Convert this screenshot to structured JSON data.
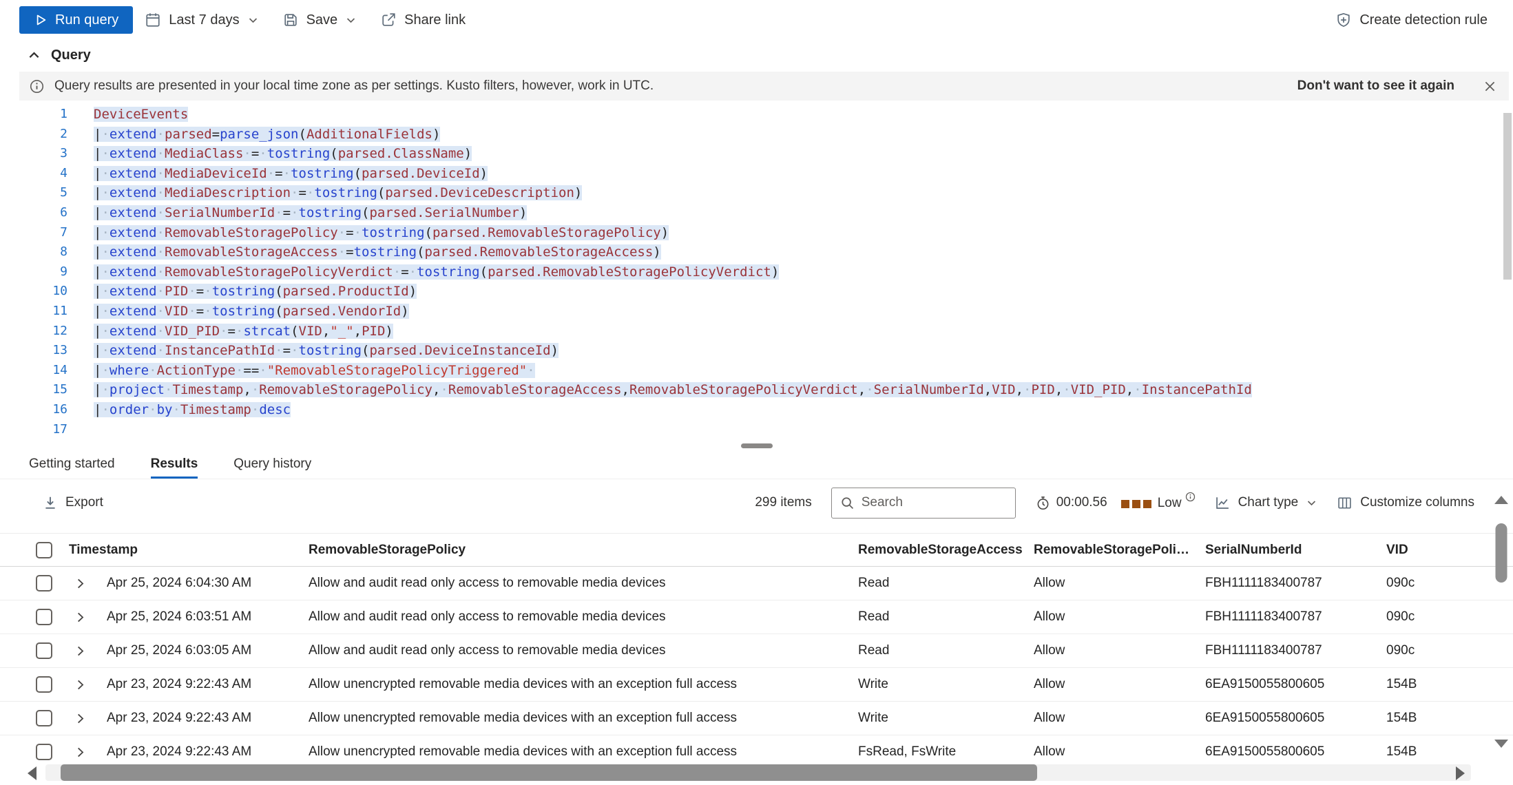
{
  "colors": {
    "accent": "#1065c0",
    "run_button_bg": "#1065c0",
    "tab_underline": "#1065c0",
    "code_selection_bg": "#dbe7f6",
    "code_keyword": "#2743cd",
    "code_column": "#9a3339",
    "code_string": "#c0392e",
    "code_line_number": "#2472c8",
    "resource_indicator": "#9a4f12"
  },
  "command_bar": {
    "run_query": "Run query",
    "time_range": "Last 7 days",
    "save": "Save",
    "share_link": "Share link",
    "create_detection_rule": "Create detection rule"
  },
  "query_section": {
    "title": "Query",
    "banner": {
      "message": "Query results are presented in your local time zone as per settings. Kusto filters, however, work in UTC.",
      "dismiss_label": "Don't want to see it again"
    }
  },
  "editor": {
    "lines": [
      {
        "n": 1,
        "tokens": [
          [
            "col",
            "DeviceEvents"
          ]
        ]
      },
      {
        "n": 2,
        "tokens": [
          [
            "p",
            "|"
          ],
          [
            "ws",
            "·"
          ],
          [
            "kw",
            "extend"
          ],
          [
            "ws",
            "·"
          ],
          [
            "col",
            "parsed"
          ],
          [
            "p",
            "="
          ],
          [
            "fn",
            "parse_json"
          ],
          [
            "p",
            "("
          ],
          [
            "col",
            "AdditionalFields"
          ],
          [
            "p",
            ")"
          ]
        ]
      },
      {
        "n": 3,
        "tokens": [
          [
            "p",
            "|"
          ],
          [
            "ws",
            "·"
          ],
          [
            "kw",
            "extend"
          ],
          [
            "ws",
            "·"
          ],
          [
            "col",
            "MediaClass"
          ],
          [
            "ws",
            "·"
          ],
          [
            "p",
            "="
          ],
          [
            "ws",
            "·"
          ],
          [
            "fn",
            "tostring"
          ],
          [
            "p",
            "("
          ],
          [
            "col",
            "parsed.ClassName"
          ],
          [
            "p",
            ")"
          ]
        ]
      },
      {
        "n": 4,
        "tokens": [
          [
            "p",
            "|"
          ],
          [
            "ws",
            "·"
          ],
          [
            "kw",
            "extend"
          ],
          [
            "ws",
            "·"
          ],
          [
            "col",
            "MediaDeviceId"
          ],
          [
            "ws",
            "·"
          ],
          [
            "p",
            "="
          ],
          [
            "ws",
            "·"
          ],
          [
            "fn",
            "tostring"
          ],
          [
            "p",
            "("
          ],
          [
            "col",
            "parsed.DeviceId"
          ],
          [
            "p",
            ")"
          ]
        ]
      },
      {
        "n": 5,
        "tokens": [
          [
            "p",
            "|"
          ],
          [
            "ws",
            "·"
          ],
          [
            "kw",
            "extend"
          ],
          [
            "ws",
            "·"
          ],
          [
            "col",
            "MediaDescription"
          ],
          [
            "ws",
            "·"
          ],
          [
            "p",
            "="
          ],
          [
            "ws",
            "·"
          ],
          [
            "fn",
            "tostring"
          ],
          [
            "p",
            "("
          ],
          [
            "col",
            "parsed.DeviceDescription"
          ],
          [
            "p",
            ")"
          ]
        ]
      },
      {
        "n": 6,
        "tokens": [
          [
            "p",
            "|"
          ],
          [
            "ws",
            "·"
          ],
          [
            "kw",
            "extend"
          ],
          [
            "ws",
            "·"
          ],
          [
            "col",
            "SerialNumberId"
          ],
          [
            "ws",
            "·"
          ],
          [
            "p",
            "="
          ],
          [
            "ws",
            "·"
          ],
          [
            "fn",
            "tostring"
          ],
          [
            "p",
            "("
          ],
          [
            "col",
            "parsed.SerialNumber"
          ],
          [
            "p",
            ")"
          ]
        ]
      },
      {
        "n": 7,
        "tokens": [
          [
            "p",
            "|"
          ],
          [
            "ws",
            "·"
          ],
          [
            "kw",
            "extend"
          ],
          [
            "ws",
            "·"
          ],
          [
            "col",
            "RemovableStoragePolicy"
          ],
          [
            "ws",
            "·"
          ],
          [
            "p",
            "="
          ],
          [
            "ws",
            "·"
          ],
          [
            "fn",
            "tostring"
          ],
          [
            "p",
            "("
          ],
          [
            "col",
            "parsed.RemovableStoragePolicy"
          ],
          [
            "p",
            ")"
          ]
        ]
      },
      {
        "n": 8,
        "tokens": [
          [
            "p",
            "|"
          ],
          [
            "ws",
            "·"
          ],
          [
            "kw",
            "extend"
          ],
          [
            "ws",
            "·"
          ],
          [
            "col",
            "RemovableStorageAccess"
          ],
          [
            "ws",
            "·"
          ],
          [
            "p",
            "="
          ],
          [
            "fn",
            "tostring"
          ],
          [
            "p",
            "("
          ],
          [
            "col",
            "parsed.RemovableStorageAccess"
          ],
          [
            "p",
            ")"
          ]
        ]
      },
      {
        "n": 9,
        "tokens": [
          [
            "p",
            "|"
          ],
          [
            "ws",
            "·"
          ],
          [
            "kw",
            "extend"
          ],
          [
            "ws",
            "·"
          ],
          [
            "col",
            "RemovableStoragePolicyVerdict"
          ],
          [
            "ws",
            "·"
          ],
          [
            "p",
            "="
          ],
          [
            "ws",
            "·"
          ],
          [
            "fn",
            "tostring"
          ],
          [
            "p",
            "("
          ],
          [
            "col",
            "parsed.RemovableStoragePolicyVerdict"
          ],
          [
            "p",
            ")"
          ]
        ]
      },
      {
        "n": 10,
        "tokens": [
          [
            "p",
            "|"
          ],
          [
            "ws",
            "·"
          ],
          [
            "kw",
            "extend"
          ],
          [
            "ws",
            "·"
          ],
          [
            "col",
            "PID"
          ],
          [
            "ws",
            "·"
          ],
          [
            "p",
            "="
          ],
          [
            "ws",
            "·"
          ],
          [
            "fn",
            "tostring"
          ],
          [
            "p",
            "("
          ],
          [
            "col",
            "parsed.ProductId"
          ],
          [
            "p",
            ")"
          ]
        ]
      },
      {
        "n": 11,
        "tokens": [
          [
            "p",
            "|"
          ],
          [
            "ws",
            "·"
          ],
          [
            "kw",
            "extend"
          ],
          [
            "ws",
            "·"
          ],
          [
            "col",
            "VID"
          ],
          [
            "ws",
            "·"
          ],
          [
            "p",
            "="
          ],
          [
            "ws",
            "·"
          ],
          [
            "fn",
            "tostring"
          ],
          [
            "p",
            "("
          ],
          [
            "col",
            "parsed.VendorId"
          ],
          [
            "p",
            ")"
          ]
        ]
      },
      {
        "n": 12,
        "tokens": [
          [
            "p",
            "|"
          ],
          [
            "ws",
            "·"
          ],
          [
            "kw",
            "extend"
          ],
          [
            "ws",
            "·"
          ],
          [
            "col",
            "VID_PID"
          ],
          [
            "ws",
            "·"
          ],
          [
            "p",
            "="
          ],
          [
            "ws",
            "·"
          ],
          [
            "fn",
            "strcat"
          ],
          [
            "p",
            "("
          ],
          [
            "col",
            "VID"
          ],
          [
            "p",
            ","
          ],
          [
            "str",
            "\"_\""
          ],
          [
            "p",
            ","
          ],
          [
            "col",
            "PID"
          ],
          [
            "p",
            ")"
          ]
        ]
      },
      {
        "n": 13,
        "tokens": [
          [
            "p",
            "|"
          ],
          [
            "ws",
            "·"
          ],
          [
            "kw",
            "extend"
          ],
          [
            "ws",
            "·"
          ],
          [
            "col",
            "InstancePathId"
          ],
          [
            "ws",
            "·"
          ],
          [
            "p",
            "="
          ],
          [
            "ws",
            "·"
          ],
          [
            "fn",
            "tostring"
          ],
          [
            "p",
            "("
          ],
          [
            "col",
            "parsed.DeviceInstanceId"
          ],
          [
            "p",
            ")"
          ]
        ]
      },
      {
        "n": 14,
        "tokens": [
          [
            "p",
            "|"
          ],
          [
            "ws",
            "·"
          ],
          [
            "kw",
            "where"
          ],
          [
            "ws",
            "·"
          ],
          [
            "col",
            "ActionType"
          ],
          [
            "ws",
            "·"
          ],
          [
            "p",
            "=="
          ],
          [
            "ws",
            "·"
          ],
          [
            "str",
            "\"RemovableStoragePolicyTriggered\""
          ],
          [
            "ws",
            "·"
          ]
        ]
      },
      {
        "n": 15,
        "tokens": [
          [
            "p",
            "|"
          ],
          [
            "ws",
            "·"
          ],
          [
            "kw",
            "project"
          ],
          [
            "ws",
            "·"
          ],
          [
            "col",
            "Timestamp"
          ],
          [
            "p",
            ","
          ],
          [
            "ws",
            "·"
          ],
          [
            "col",
            "RemovableStoragePolicy"
          ],
          [
            "p",
            ","
          ],
          [
            "ws",
            "·"
          ],
          [
            "col",
            "RemovableStorageAccess"
          ],
          [
            "p",
            ","
          ],
          [
            "col",
            "RemovableStoragePolicyVerdict"
          ],
          [
            "p",
            ","
          ],
          [
            "ws",
            "·"
          ],
          [
            "col",
            "SerialNumberId"
          ],
          [
            "p",
            ","
          ],
          [
            "col",
            "VID"
          ],
          [
            "p",
            ","
          ],
          [
            "ws",
            "·"
          ],
          [
            "col",
            "PID"
          ],
          [
            "p",
            ","
          ],
          [
            "ws",
            "·"
          ],
          [
            "col",
            "VID_PID"
          ],
          [
            "p",
            ","
          ],
          [
            "ws",
            "·"
          ],
          [
            "col",
            "InstancePathId"
          ]
        ]
      },
      {
        "n": 16,
        "tokens": [
          [
            "p",
            "|"
          ],
          [
            "ws",
            "·"
          ],
          [
            "kw",
            "order"
          ],
          [
            "ws",
            "·"
          ],
          [
            "kw",
            "by"
          ],
          [
            "ws",
            "·"
          ],
          [
            "col",
            "Timestamp"
          ],
          [
            "ws",
            "·"
          ],
          [
            "kw",
            "desc"
          ]
        ]
      },
      {
        "n": 17,
        "tokens": []
      }
    ]
  },
  "tabs": [
    {
      "label": "Getting started"
    },
    {
      "label": "Results"
    },
    {
      "label": "Query history"
    }
  ],
  "results_toolbar": {
    "export_label": "Export",
    "items_count": "299 items",
    "search_placeholder": "Search",
    "elapsed_time": "00:00.56",
    "resource_usage_label": "Low",
    "chart_type_label": "Chart type",
    "customize_columns_label": "Customize columns"
  },
  "table": {
    "columns": [
      "Timestamp",
      "RemovableStoragePolicy",
      "RemovableStorageAccess",
      "RemovableStoragePolicyVer...",
      "SerialNumberId",
      "VID"
    ],
    "rows": [
      {
        "timestamp": "Apr 25, 2024 6:04:30 AM",
        "policy": "Allow and audit read only access to removable media devices",
        "access": "Read",
        "verdict": "Allow",
        "serial": "FBH1111183400787",
        "vid": "090c"
      },
      {
        "timestamp": "Apr 25, 2024 6:03:51 AM",
        "policy": "Allow and audit read only access to removable media devices",
        "access": "Read",
        "verdict": "Allow",
        "serial": "FBH1111183400787",
        "vid": "090c"
      },
      {
        "timestamp": "Apr 25, 2024 6:03:05 AM",
        "policy": "Allow and audit read only access to removable media devices",
        "access": "Read",
        "verdict": "Allow",
        "serial": "FBH1111183400787",
        "vid": "090c"
      },
      {
        "timestamp": "Apr 23, 2024 9:22:43 AM",
        "policy": "Allow unencrypted removable media devices with an exception full access",
        "access": "Write",
        "verdict": "Allow",
        "serial": "6EA9150055800605",
        "vid": "154B"
      },
      {
        "timestamp": "Apr 23, 2024 9:22:43 AM",
        "policy": "Allow unencrypted removable media devices with an exception full access",
        "access": "Write",
        "verdict": "Allow",
        "serial": "6EA9150055800605",
        "vid": "154B"
      },
      {
        "timestamp": "Apr 23, 2024 9:22:43 AM",
        "policy": "Allow unencrypted removable media devices with an exception full access",
        "access": "FsRead, FsWrite",
        "verdict": "Allow",
        "serial": "6EA9150055800605",
        "vid": "154B"
      }
    ]
  }
}
